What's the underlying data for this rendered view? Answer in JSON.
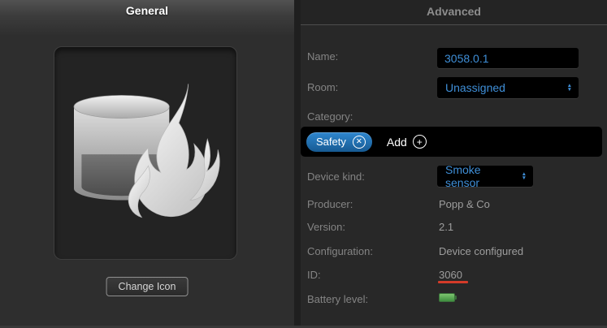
{
  "sections": {
    "general": {
      "title": "General",
      "change_icon_button": "Change Icon",
      "device_icon": "smoke-detector-with-flame"
    },
    "advanced": {
      "title": "Advanced",
      "fields": {
        "name": {
          "label": "Name:",
          "value": "3058.0.1"
        },
        "room": {
          "label": "Room:",
          "value": "Unassigned"
        },
        "category": {
          "label": "Category:",
          "tags": [
            {
              "label": "Safety",
              "remove_glyph": "✕"
            }
          ],
          "add": {
            "label": "Add",
            "glyph": "+"
          }
        },
        "device_kind": {
          "label": "Device kind:",
          "value": "Smoke sensor"
        },
        "producer": {
          "label": "Producer:",
          "value": "Popp & Co"
        },
        "version": {
          "label": "Version:",
          "value": "2.1"
        },
        "configuration": {
          "label": "Configuration:",
          "value": "Device configured"
        },
        "id": {
          "label": "ID:",
          "value": "3060",
          "highlight": "red-underline"
        },
        "battery": {
          "label": "Battery level:",
          "icon": "battery-full",
          "status_color": "#55a84f"
        }
      }
    }
  },
  "icons": {
    "stepper_up": "▲",
    "stepper_down": "▼"
  },
  "colors": {
    "accent_blue": "#3f8fd8",
    "tag_blue_top": "#2f87cf",
    "tag_blue_bottom": "#175a92",
    "id_underline_red": "#d43b29",
    "battery_green": "#55a84f",
    "panel_dark": "#282828",
    "input_black": "#000000"
  }
}
